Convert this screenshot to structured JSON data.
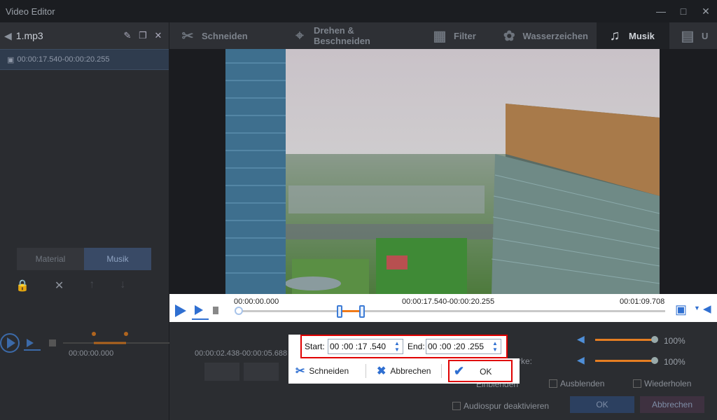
{
  "window": {
    "title": "Video Editor"
  },
  "left_panel": {
    "file_name": "1.mp3",
    "clip_time": "00:00:17.540-00:00:20.255",
    "tabs": [
      "Material",
      "Musik"
    ],
    "timeline_start": "00:00:00.000",
    "timeline_range": "00:00:02.438-00:00:05.688"
  },
  "top_tabs": [
    {
      "label": "Schneiden",
      "icon": "scissors-icon"
    },
    {
      "label": "Drehen & Beschneiden",
      "icon": "crop-icon"
    },
    {
      "label": "Filter",
      "icon": "filter-icon"
    },
    {
      "label": "Wasserzeichen",
      "icon": "watermark-icon"
    },
    {
      "label": "Musik",
      "icon": "music-icon"
    },
    {
      "label": "U",
      "icon": "subtitle-icon"
    }
  ],
  "player": {
    "time_start": "00:00:00.000",
    "time_selection": "00:00:17.540-00:00:20.255",
    "time_end": "00:01:09.708"
  },
  "range_popup": {
    "start_label": "Start:",
    "start_value": "00 :00 :17 .540",
    "end_label": "End:",
    "end_value": "00 :00 :20 .255"
  },
  "action_popup": {
    "cut_label": "Schneiden",
    "cancel_label": "Abbrechen",
    "ok_label": "OK"
  },
  "audio_options": {
    "volume1": "100%",
    "volume2": "100%",
    "partial_label": "rke:",
    "fade_in": "Einblenden",
    "fade_out": "Ausblenden",
    "repeat": "Wiederholen",
    "disable_audio": "Audiospur deaktivieren",
    "ok": "OK",
    "cancel": "Abbrechen"
  },
  "colors": {
    "accent": "#2f6fd1",
    "highlight": "#e00000",
    "orange": "#f07a19"
  }
}
